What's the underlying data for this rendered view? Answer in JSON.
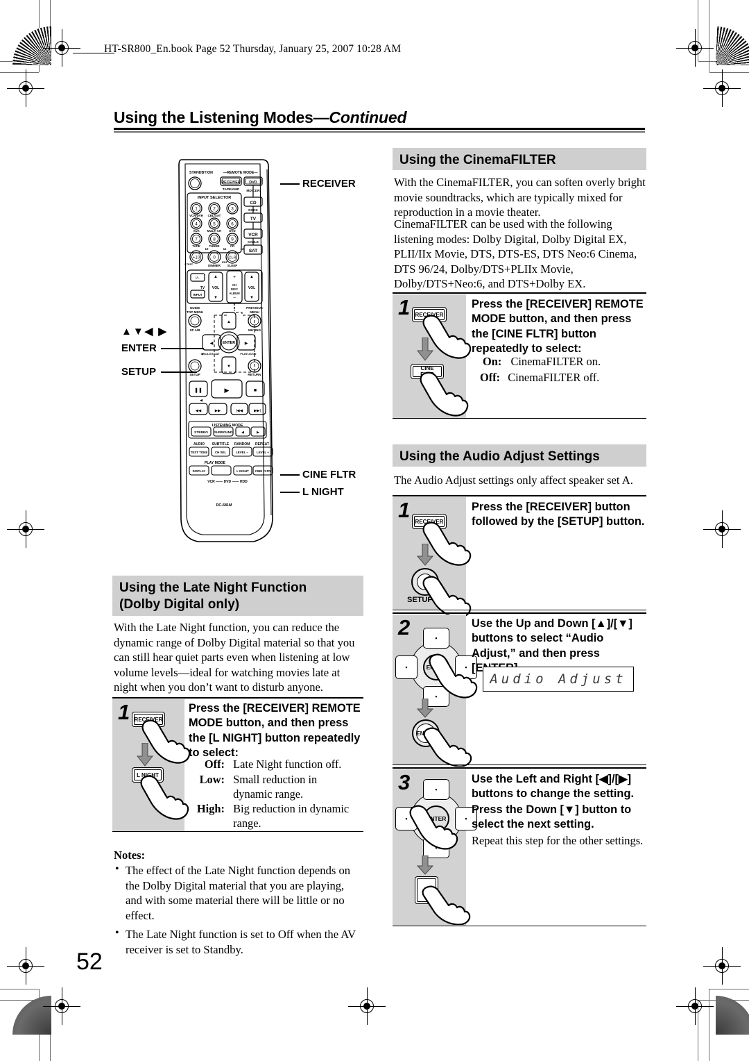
{
  "book_header": "HT-SR800_En.book  Page 52  Thursday, January 25, 2007  10:28 AM",
  "running_title": {
    "main": "Using the Listening Modes",
    "continued": "—Continued"
  },
  "page_number": "52",
  "remote": {
    "model": "RC-681M",
    "standby_label": "STANDBY/ON",
    "remote_mode_label": "REMOTE MODE",
    "input_selector_label": "INPUT SELECTOR",
    "mode_keys": [
      "RECEIVER",
      "DVD",
      "CD",
      "TV",
      "VCR",
      "SAT"
    ],
    "mode_sublabels": [
      "TAPE/AMP",
      "MD/CDR",
      "DOCK",
      "CABLE"
    ],
    "numeric_sublabels": [
      "VCR/DVR",
      "CBL/SAT",
      "",
      "AUX",
      "MULTI CH",
      "DVD",
      "TAPE",
      "TUNER",
      "CD"
    ],
    "keys_row4": [
      "+10",
      "0",
      "CLR"
    ],
    "keys_row4_sub": [
      "DIMMER",
      "SLEEP",
      "ENT"
    ],
    "vol_labels": [
      "TV",
      "VOL",
      "CH",
      "DISC",
      "ALBUM",
      "VOL",
      "INPUT"
    ],
    "menu_labels": [
      "GUIDE",
      "TOP MENU",
      "PREVIOUS",
      "MENU",
      "SP A/B",
      "MUTING",
      "ENTER",
      "SETUP",
      "RETURN"
    ],
    "listening_mode_label": "LISTENING MODE",
    "listening_keys": [
      "STEREO",
      "SURROUND"
    ],
    "fn_labels": [
      "AUDIO",
      "SUBTITLE",
      "RANDOM",
      "REPEAT"
    ],
    "fn_keys": [
      "TEST TONE",
      "CH SEL",
      "LEVEL –",
      "LEVEL +"
    ],
    "play_mode_label": "PLAY MODE",
    "bottom_keys": [
      "DISPLAY",
      "L NIGHT",
      "CINE FLTR"
    ],
    "device_row": "VCR —— DVD —— HDD",
    "callouts": {
      "receiver": "RECEIVER",
      "dpad": "▲▼◀ ▶",
      "enter": "ENTER",
      "setup": "SETUP",
      "cine_fltr": "CINE FLTR",
      "l_night": "L NIGHT"
    }
  },
  "cinemafilter": {
    "heading": "Using the CinemaFILTER",
    "paragraph1": "With the CinemaFILTER, you can soften overly bright movie soundtracks, which are typically mixed for reproduction in a movie theater.",
    "paragraph2": "CinemaFILTER can be used with the following listening modes: Dolby Digital, Dolby Digital EX, PLII/IIx Movie, DTS, DTS-ES, DTS Neo:6 Cinema, DTS 96/24, Dolby/DTS+PLIIx Movie, Dolby/DTS+Neo:6, and DTS+Dolby EX.",
    "step1": {
      "number": "1",
      "heading": "Press the [RECEIVER] REMOTE MODE button, and then press the [CINE FLTR] button repeatedly to select:",
      "key_top": "RECEIVER",
      "key_bottom": "CINE FLTR",
      "options": [
        {
          "term": "On:",
          "desc": "CinemaFILTER on."
        },
        {
          "term": "Off:",
          "desc": "CinemaFILTER off."
        }
      ]
    }
  },
  "audio_adjust": {
    "heading": "Using the Audio Adjust Settings",
    "intro": "The Audio Adjust settings only affect speaker set A.",
    "steps": [
      {
        "number": "1",
        "heading": "Press the [RECEIVER] button followed by the [SETUP] button.",
        "key_top": "RECEIVER",
        "key_bottom": "SETUP"
      },
      {
        "number": "2",
        "heading": "Use the Up and Down [▲]/[▼] buttons to select “Audio Adjust,” and then press [ENTER].",
        "key_center": "ENTER",
        "key_bottom": "ENTER",
        "display": "Audio Adjust"
      },
      {
        "number": "3",
        "heading_line1": "Use the Left and Right [◀]/[▶] buttons to change the setting.",
        "heading_line2": "Press the Down [▼] button to select the next setting.",
        "key_center": "ENTER",
        "body": "Repeat this step for the other settings."
      }
    ]
  },
  "late_night": {
    "heading_line1": "Using the Late Night Function",
    "heading_line2": "(Dolby Digital only)",
    "paragraph": "With the Late Night function, you can reduce the dynamic range of Dolby Digital material so that you can still hear quiet parts even when listening at low volume levels—ideal for watching movies late at night when you don’t want to disturb anyone.",
    "step1": {
      "number": "1",
      "heading": "Press the [RECEIVER] REMOTE MODE button, and then press the [L NIGHT] button repeatedly to select:",
      "key_top": "RECEIVER",
      "key_bottom": "L NIGHT",
      "options": [
        {
          "term": "Off:",
          "desc": "Late Night function off."
        },
        {
          "term": "Low:",
          "desc": "Small reduction in dynamic range."
        },
        {
          "term": "High:",
          "desc": "Big reduction in dynamic range."
        }
      ]
    },
    "notes_label": "Notes:",
    "notes": [
      "The effect of the Late Night function depends on the Dolby Digital material that you are playing, and with some material there will be little or no effect.",
      "The Late Night function is set to Off when the AV receiver is set to Standby."
    ]
  }
}
